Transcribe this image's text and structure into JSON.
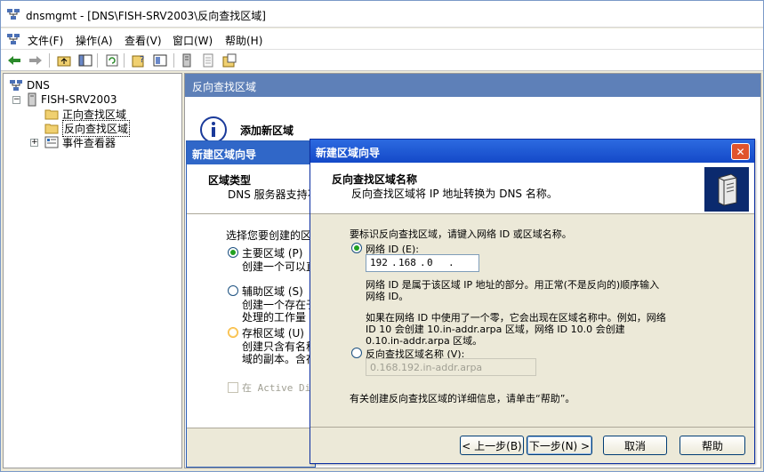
{
  "window": {
    "title": "dnsmgmt - [DNS\\FISH-SRV2003\\反向查找区域]"
  },
  "menu": {
    "items": [
      "文件(F)",
      "操作(A)",
      "查看(V)",
      "窗口(W)",
      "帮助(H)"
    ]
  },
  "tree": {
    "root": "DNS",
    "server": "FISH-SRV2003",
    "forward_zone": "正向查找区域",
    "reverse_zone": "反向查找区域",
    "event_viewer": "事件查看器"
  },
  "right_pane": {
    "header": "反向查找区域",
    "add_zone": "添加新区域"
  },
  "wizard_back": {
    "title": "新建区域向导",
    "section_title": "区域类型",
    "section_desc": "DNS 服务器支持不",
    "prompt": "选择您要创建的区",
    "primary_label": "主要区域 (P)",
    "primary_desc": "创建一个可以直",
    "secondary_label": "辅助区域 (S)",
    "secondary_desc_1": "创建一个存在于",
    "secondary_desc_2": "处理的工作量",
    "stub_label": "存根区域 (U)",
    "stub_desc_1": "创建只含有名称",
    "stub_desc_2": "域的副本。含存",
    "active_dir_label": "在 Active Dir"
  },
  "wizard_front": {
    "title": "新建区域向导",
    "close_glyph": "✕",
    "section_title": "反向查找区域名称",
    "section_desc": "反向查找区域将 IP 地址转换为 DNS 名称。",
    "intro": "要标识反向查找区域，请键入网络 ID 或区域名称。",
    "network_id_label": "网络 ID (E):",
    "network_id": {
      "oct1": "192",
      "oct2": "168",
      "oct3": "0",
      "oct4": ""
    },
    "network_id_desc_1": "网络 ID 是属于该区域 IP 地址的部分。用正常(不是反向的)顺序输入",
    "network_id_desc_2": "网络 ID。",
    "zero_note_1": "如果在网络 ID 中使用了一个零，它会出现在区域名称中。例如，网络",
    "zero_note_2": "ID 10 会创建 10.in-addr.arpa 区域，网络 ID 10.0 会创建",
    "zero_note_3": "0.10.in-addr.arpa 区域。",
    "zone_name_label": "反向查找区域名称 (V):",
    "zone_name_value": "0.168.192.in-addr.arpa",
    "help_note": "有关创建反向查找区域的详细信息，请单击“帮助”。",
    "buttons": {
      "back": "< 上一步(B)",
      "next": "下一步(N) >",
      "cancel": "取消",
      "help": "帮助"
    }
  },
  "colors": {
    "accent_blue": "#3067c8",
    "header_blue": "#5e80b8",
    "close_red": "#e0542c",
    "radio_green": "#21a121"
  }
}
